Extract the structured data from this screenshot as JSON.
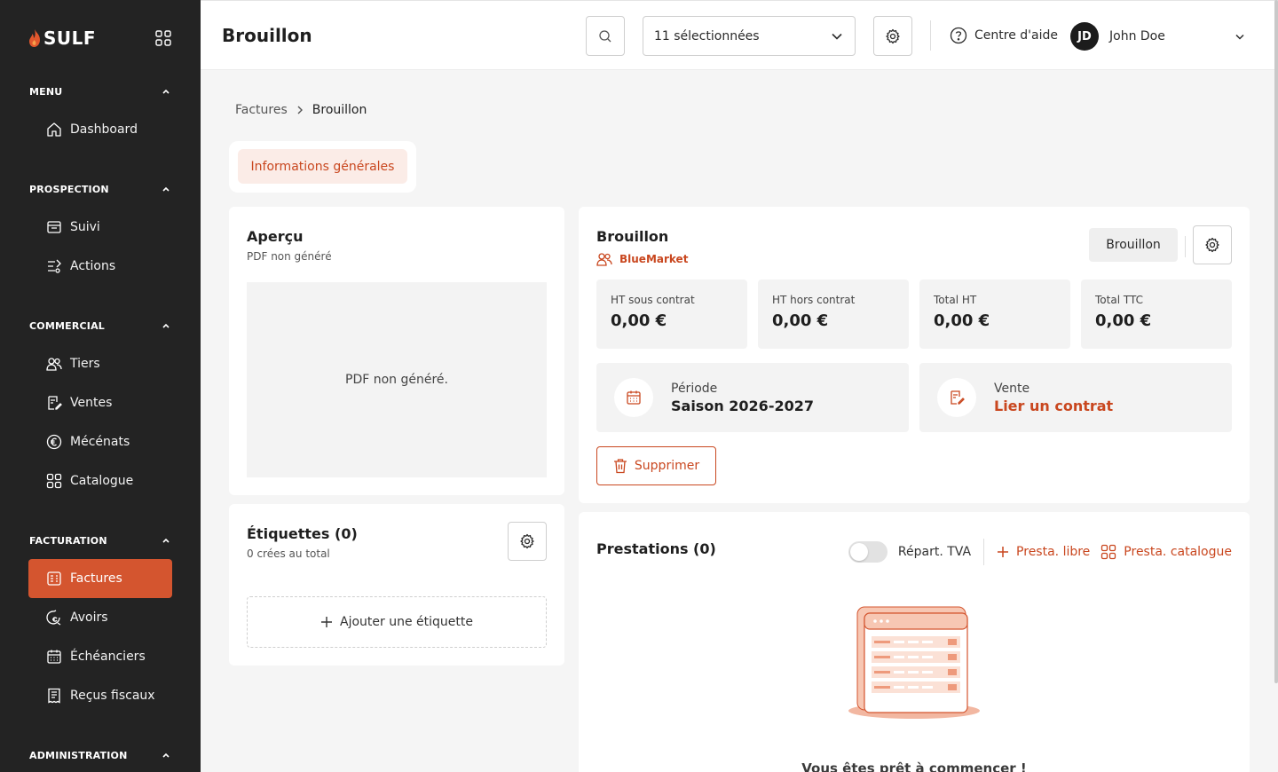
{
  "brand": {
    "name": "SULF",
    "accent": "#d4552f"
  },
  "sidebar": {
    "sections": [
      {
        "title": "MENU",
        "items": [
          {
            "label": "Dashboard",
            "icon": "home-icon"
          }
        ]
      },
      {
        "title": "PROSPECTION",
        "items": [
          {
            "label": "Suivi",
            "icon": "folder-icon"
          },
          {
            "label": "Actions",
            "icon": "actions-icon"
          }
        ]
      },
      {
        "title": "COMMERCIAL",
        "items": [
          {
            "label": "Tiers",
            "icon": "users-icon"
          },
          {
            "label": "Ventes",
            "icon": "contract-icon"
          },
          {
            "label": "Mécénats",
            "icon": "euro-icon"
          },
          {
            "label": "Catalogue",
            "icon": "grid-icon"
          }
        ]
      },
      {
        "title": "FACTURATION",
        "items": [
          {
            "label": "Factures",
            "icon": "invoice-icon",
            "active": true
          },
          {
            "label": "Avoirs",
            "icon": "refund-icon"
          },
          {
            "label": "Échéanciers",
            "icon": "calendar-icon"
          },
          {
            "label": "Reçus fiscaux",
            "icon": "receipt-icon"
          }
        ]
      },
      {
        "title": "ADMINISTRATION",
        "items": []
      }
    ]
  },
  "header": {
    "title": "Brouillon",
    "select_value": "11 sélectionnées",
    "help_label": "Centre d'aide",
    "user": {
      "initials": "JD",
      "name": "John Doe"
    }
  },
  "breadcrumb": {
    "parent": "Factures",
    "current": "Brouillon"
  },
  "tabs": {
    "active": "Informations générales"
  },
  "preview": {
    "title": "Aperçu",
    "subtitle": "PDF non généré",
    "placeholder": "PDF non généré."
  },
  "labels": {
    "title": "Étiquettes (0)",
    "subtitle": "0 crées au total",
    "add": "Ajouter une étiquette"
  },
  "draft": {
    "title": "Brouillon",
    "client": "BlueMarket",
    "status": "Brouillon",
    "totals": [
      {
        "label": "HT sous contrat",
        "value": "0,00 €"
      },
      {
        "label": "HT hors contrat",
        "value": "0,00 €"
      },
      {
        "label": "Total HT",
        "value": "0,00 €"
      },
      {
        "label": "Total TTC",
        "value": "0,00 €"
      }
    ],
    "period": {
      "label": "Période",
      "value": "Saison 2026-2027"
    },
    "sale": {
      "label": "Vente",
      "link": "Lier un contrat"
    },
    "delete": "Supprimer"
  },
  "presta": {
    "title": "Prestations (0)",
    "vat_toggle": "Répart. TVA",
    "free": "Presta. libre",
    "catalog": "Presta. catalogue",
    "empty_text": "Vous êtes prêt à commencer !"
  }
}
